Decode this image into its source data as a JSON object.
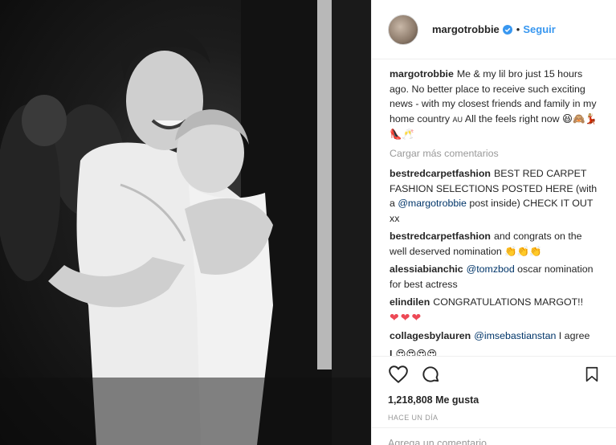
{
  "post": {
    "username": "margotrobbie",
    "follow_label": "Seguir",
    "separator": "•",
    "caption": {
      "username": "margotrobbie",
      "text": "Me & my lil bro just 15 hours ago. No better place to receive such exciting news - with my closest friends and family in my home country",
      "suffix": "All the feels right now",
      "flag": "AU",
      "emojis": "😆🙈💃🏼👠🥂"
    },
    "load_more": "Cargar más comentarios",
    "comments": [
      {
        "username": "bestredcarpetfashion",
        "pre": "BEST RED CARPET FASHION SELECTIONS POSTED HERE (with a ",
        "mention": "@margotrobbie",
        "post": " post inside) CHECK IT OUT xx"
      },
      {
        "username": "bestredcarpetfashion",
        "pre": "and congrats on the well deserved nomination ",
        "emojis": "👏👏👏"
      },
      {
        "username": "alessiabianchic",
        "mention": "@tomzbod",
        "post": " oscar nomination for best actress"
      },
      {
        "username": "elindilen",
        "pre": "CONGRATULATIONS MARGOT!!",
        "hearts": "❤❤❤"
      },
      {
        "username": "collagesbylauren",
        "mention": "@imsebastianstan",
        "post": " I agree"
      },
      {
        "username": "l",
        "emojis": "😍😍😍😍"
      }
    ],
    "likes": "1,218,808 Me gusta",
    "timestamp": "HACE UN DÍA",
    "add_comment_placeholder": "Agrega un comentario..."
  },
  "colors": {
    "link": "#3897f0",
    "mention": "#003569",
    "muted": "#999999",
    "heart": "#ed4956"
  },
  "icons": {
    "like": "heart-outline-icon",
    "comment": "speech-bubble-icon",
    "save": "bookmark-icon",
    "verified": "verified-badge-icon"
  }
}
